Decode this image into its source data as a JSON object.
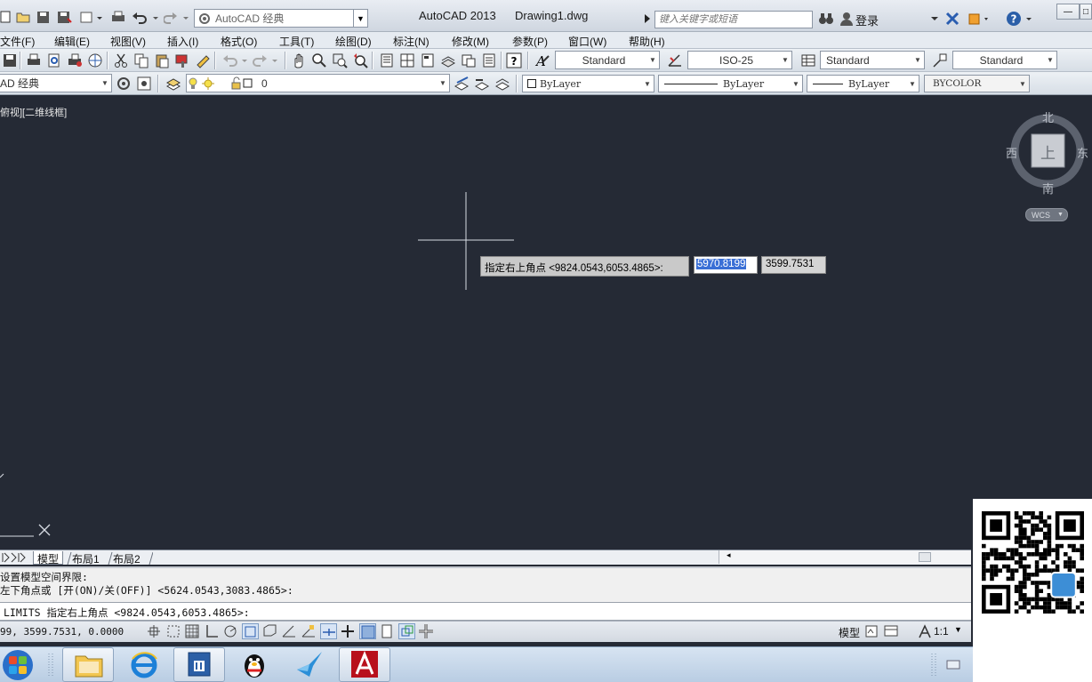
{
  "titlebar": {
    "workspace": "AutoCAD 经典",
    "app_title": "AutoCAD 2013",
    "doc_title": "Drawing1.dwg",
    "search_placeholder": "键入关键字或短语",
    "login": "登录"
  },
  "menu": [
    "文件(F)",
    "编辑(E)",
    "视图(V)",
    "插入(I)",
    "格式(O)",
    "工具(T)",
    "绘图(D)",
    "标注(N)",
    "修改(M)",
    "参数(P)",
    "窗口(W)",
    "帮助(H)"
  ],
  "styles_toolbar": {
    "text_style": "Standard",
    "dim_style": "ISO-25",
    "table_style": "Standard",
    "mleader_style": "Standard"
  },
  "layers_toolbar": {
    "workspace": "AD 经典",
    "layer": "0",
    "color": "ByLayer",
    "linetype": "ByLayer",
    "lineweight": "ByLayer",
    "plot_style": "BYCOLOR"
  },
  "viewport_label": "俯视][二维线框]",
  "viewcube": {
    "north": "北",
    "south": "南",
    "east": "东",
    "west": "西",
    "top": "上",
    "wcs": "WCS"
  },
  "dynamic_input": {
    "prompt": "指定右上角点 <9824.0543,6053.4865>:",
    "x_value": "5970.8199",
    "y_value": "3599.7531"
  },
  "layout_tabs": [
    "模型",
    "布局1",
    "布局2"
  ],
  "command_history": [
    "设置模型空间界限:",
    "左下角点或 [开(ON)/关(OFF)] <5624.0543,3083.4865>:"
  ],
  "command_line": "LIMITS 指定右上角点 <9824.0543,6053.4865>:",
  "status": {
    "coords": "99, 3599.7531, 0.0000",
    "model": "模型",
    "scale": "1:1"
  },
  "colors": {
    "canvas": "#252a35",
    "selection": "#3a6fd6"
  }
}
